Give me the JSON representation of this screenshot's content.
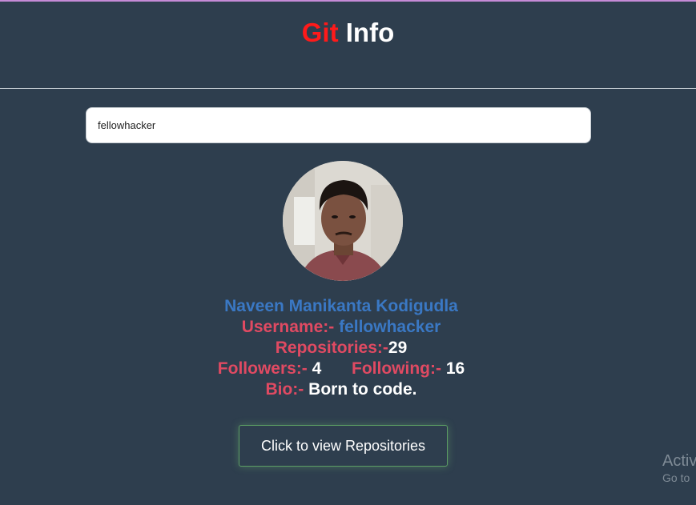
{
  "header": {
    "title_part1": "Git",
    "title_part2": "Info"
  },
  "search": {
    "value": "fellowhacker"
  },
  "profile": {
    "name": "Naveen Manikanta Kodigudla",
    "username_label": "Username:-",
    "username_value": "fellowhacker",
    "repositories_label": "Repositories:-",
    "repositories_value": "29",
    "followers_label": "Followers:-",
    "followers_value": "4",
    "following_label": "Following:-",
    "following_value": "16",
    "bio_label": "Bio:-",
    "bio_value": "Born to code."
  },
  "actions": {
    "view_repos_label": "Click to view Repositories"
  },
  "watermark": {
    "line1": "Activ",
    "line2": "Go to"
  },
  "colors": {
    "background": "#2e3e4e",
    "accent_red": "#ff1a1a",
    "label_red": "#e04a62",
    "link_blue": "#3a78c4",
    "button_border": "#5c9e64"
  }
}
